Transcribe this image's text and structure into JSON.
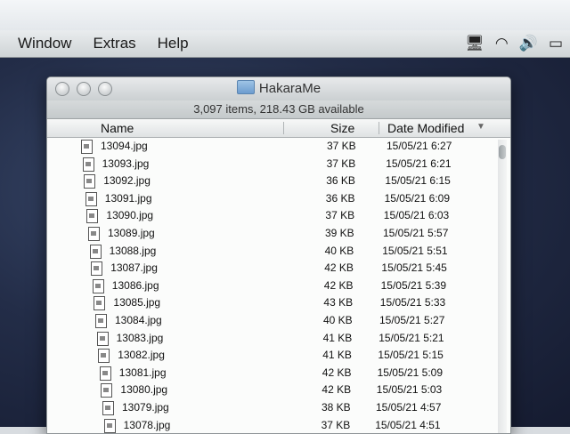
{
  "menubar": {
    "items": [
      "Window",
      "Extras",
      "Help"
    ],
    "status_icons": [
      "display-icon",
      "wifi-icon",
      "volume-icon",
      "battery-icon"
    ]
  },
  "window": {
    "title": "HakaraMe",
    "status": "3,097 items, 218.43 GB available",
    "columns": {
      "name": "Name",
      "size": "Size",
      "date": "Date Modified"
    },
    "rows": [
      {
        "name": "13094.jpg",
        "size": "37 KB",
        "date": "15/05/21 6:27"
      },
      {
        "name": "13093.jpg",
        "size": "37 KB",
        "date": "15/05/21 6:21"
      },
      {
        "name": "13092.jpg",
        "size": "36 KB",
        "date": "15/05/21 6:15"
      },
      {
        "name": "13091.jpg",
        "size": "36 KB",
        "date": "15/05/21 6:09"
      },
      {
        "name": "13090.jpg",
        "size": "37 KB",
        "date": "15/05/21 6:03"
      },
      {
        "name": "13089.jpg",
        "size": "39 KB",
        "date": "15/05/21 5:57"
      },
      {
        "name": "13088.jpg",
        "size": "40 KB",
        "date": "15/05/21 5:51"
      },
      {
        "name": "13087.jpg",
        "size": "42 KB",
        "date": "15/05/21 5:45"
      },
      {
        "name": "13086.jpg",
        "size": "42 KB",
        "date": "15/05/21 5:39"
      },
      {
        "name": "13085.jpg",
        "size": "43 KB",
        "date": "15/05/21 5:33"
      },
      {
        "name": "13084.jpg",
        "size": "40 KB",
        "date": "15/05/21 5:27"
      },
      {
        "name": "13083.jpg",
        "size": "41 KB",
        "date": "15/05/21 5:21"
      },
      {
        "name": "13082.jpg",
        "size": "41 KB",
        "date": "15/05/21 5:15"
      },
      {
        "name": "13081.jpg",
        "size": "42 KB",
        "date": "15/05/21 5:09"
      },
      {
        "name": "13080.jpg",
        "size": "42 KB",
        "date": "15/05/21 5:03"
      },
      {
        "name": "13079.jpg",
        "size": "38 KB",
        "date": "15/05/21 4:57"
      },
      {
        "name": "13078.jpg",
        "size": "37 KB",
        "date": "15/05/21 4:51"
      }
    ]
  }
}
